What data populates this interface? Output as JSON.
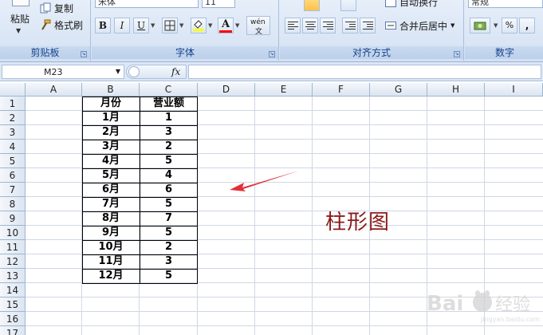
{
  "ribbon": {
    "clipboard": {
      "paste_label": "粘贴",
      "copy_label": "复制",
      "format_painter_label": "格式刷",
      "group_label": "剪贴板"
    },
    "font": {
      "font_name": "宋体",
      "font_size": "11",
      "bold": "B",
      "italic": "I",
      "underline": "U",
      "phonetic": "wén",
      "group_label": "字体",
      "fill_color": "#ffff00",
      "font_color": "#ff0000"
    },
    "alignment": {
      "wrap_text_label": "自动换行",
      "merge_center_label": "合并后居中",
      "group_label": "对齐方式"
    },
    "number": {
      "format_value": "常规",
      "percent": "%",
      "comma": ",",
      "group_label": "数字"
    }
  },
  "formula_bar": {
    "name_box": "M23",
    "fx": "fx",
    "formula": ""
  },
  "columns": [
    "A",
    "B",
    "C",
    "D",
    "E",
    "F",
    "G",
    "H",
    "I"
  ],
  "rows": [
    "1",
    "2",
    "3",
    "4",
    "5",
    "6",
    "7",
    "8",
    "9",
    "10",
    "11",
    "12",
    "13",
    "14",
    "15",
    "16",
    "17"
  ],
  "table": {
    "header": [
      "月份",
      "营业额"
    ],
    "rows": [
      [
        "1月",
        "1"
      ],
      [
        "2月",
        "3"
      ],
      [
        "3月",
        "2"
      ],
      [
        "4月",
        "5"
      ],
      [
        "5月",
        "4"
      ],
      [
        "6月",
        "6"
      ],
      [
        "7月",
        "5"
      ],
      [
        "8月",
        "7"
      ],
      [
        "9月",
        "5"
      ],
      [
        "10月",
        "2"
      ],
      [
        "11月",
        "3"
      ],
      [
        "12月",
        "5"
      ]
    ]
  },
  "annotation": {
    "text": "柱形图",
    "color": "#8b1a1a"
  },
  "arrow_color": "#e0303a"
}
